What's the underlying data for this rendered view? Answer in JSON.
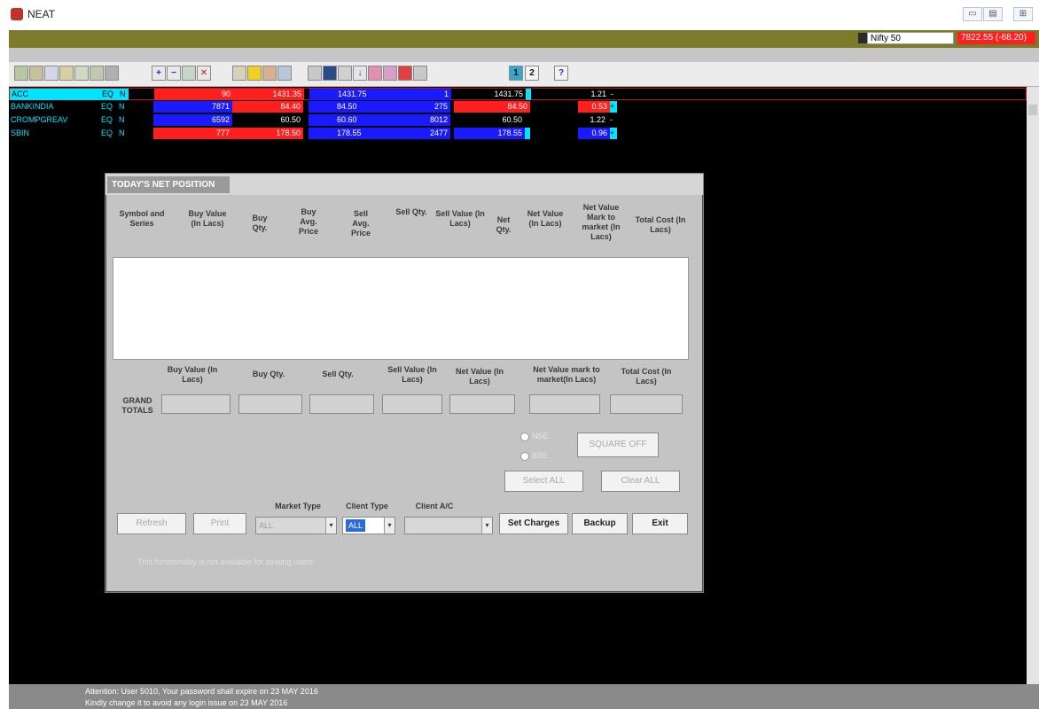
{
  "app": {
    "title": "NEAT",
    "window_buttons": [
      "▭",
      "▤",
      "⊞"
    ]
  },
  "index_bar": {
    "name": "Nifty 50",
    "value": "7822.55 (-68.20)"
  },
  "toolbar": {
    "page_buttons": [
      "1",
      "2"
    ],
    "help": "?"
  },
  "market_watch": {
    "rows": [
      {
        "symbol": "ACC",
        "series": "EQ",
        "market": "N",
        "buy_qty": "90",
        "buy_price": "1431.35",
        "sell_price": "1431.75",
        "sell_qty": "1",
        "ltp": "1431.75",
        "pct": "1.21",
        "trend": "-"
      },
      {
        "symbol": "BANKINDIA",
        "series": "EQ",
        "market": "N",
        "buy_qty": "7871",
        "buy_price": "84.40",
        "sell_price": "84.50",
        "sell_qty": "275",
        "ltp": "84.50",
        "pct": "0.53",
        "trend": "+"
      },
      {
        "symbol": "CROMPGREAV",
        "series": "EQ",
        "market": "N",
        "buy_qty": "6592",
        "buy_price": "60.50",
        "sell_price": "60.60",
        "sell_qty": "8012",
        "ltp": "60.50",
        "pct": "1.22",
        "trend": "-"
      },
      {
        "symbol": "SBIN",
        "series": "EQ",
        "market": "N",
        "buy_qty": "777",
        "buy_price": "178.50",
        "sell_price": "178.55",
        "sell_qty": "2477",
        "ltp": "178.55",
        "pct": "0.96",
        "trend": "+"
      }
    ]
  },
  "dialog": {
    "title": "TODAY'S NET POSITION",
    "columns": [
      "Symbol and Series",
      "Buy Value (In Lacs)",
      "Buy Qty.",
      "Buy Avg. Price",
      "Sell Avg. Price",
      "Sell Qty.",
      "Sell Value (In Lacs)",
      "Net Qty.",
      "Net Value (In Lacs)",
      "Net Value Mark to market (In Lacs)",
      "Total Cost (In Lacs)"
    ],
    "grand_totals_label": "GRAND TOTALS",
    "totals": [
      "Buy Value (In Lacs)",
      "Buy Qty.",
      "Sell Qty.",
      "Sell Value (In Lacs)",
      "Net Value (In Lacs)",
      "Net Value mark to market(In Lacs)",
      "Total Cost (In Lacs)"
    ],
    "radio_options": [
      "NSE",
      "BSE"
    ],
    "square_off_label": "SQUARE OFF",
    "select_all_label": "Select ALL",
    "clear_all_label": "Clear ALL",
    "market_type_label": "Market Type",
    "client_type_label": "Client Type",
    "client_ac_label": "Client A/C",
    "market_type_value": "ALL",
    "client_type_value": "ALL",
    "client_ac_value": "",
    "refresh_label": "Refresh",
    "print_label": "Print",
    "set_charges_label": "Set Charges",
    "backup_label": "Backup",
    "exit_label": "Exit",
    "notice": "This functionality is not available for dealing users"
  },
  "status": {
    "line1": "Attention: User 5010, Your password shall expire on 23 MAY 2016",
    "line2": "Kindly change it to avoid any login issue on 23 MAY 2016"
  },
  "colors": {
    "index_strip": "#7e7a2c",
    "market_bg": "#000000",
    "buy_blue": "#1a1aff",
    "sell_red": "#ff1f1f",
    "cyan": "#00e5ff"
  }
}
